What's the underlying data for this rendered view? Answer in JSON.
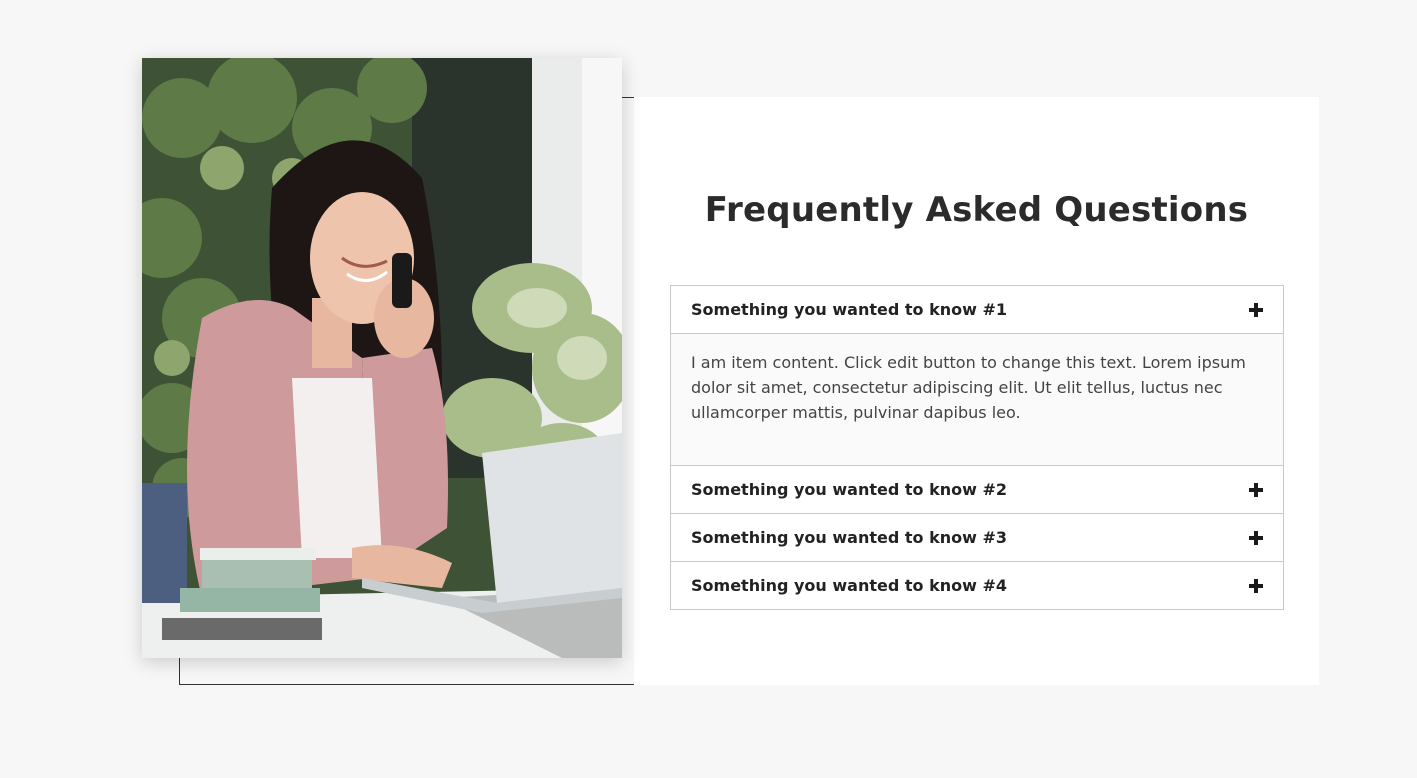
{
  "faq": {
    "title": "Frequently Asked Questions",
    "items": [
      {
        "question": "Something you wanted to know #1",
        "answer": "I am item content. Click edit button to change this text. Lorem ipsum dolor sit amet, consectetur adipiscing elit. Ut elit tellus, luctus nec ullamcorper mattis, pulvinar dapibus leo.",
        "expanded": true
      },
      {
        "question": "Something you wanted to know #2",
        "expanded": false
      },
      {
        "question": "Something you wanted to know #3",
        "expanded": false
      },
      {
        "question": "Something you wanted to know #4",
        "expanded": false
      }
    ],
    "toggle_icon": "plus-icon"
  },
  "image": {
    "subject": "woman-on-phone-at-laptop-photo"
  },
  "colors": {
    "page_background": "#f7f7f7",
    "card_background": "#ffffff",
    "title_text": "#2b2b2b",
    "border": "#c9c9c9"
  }
}
